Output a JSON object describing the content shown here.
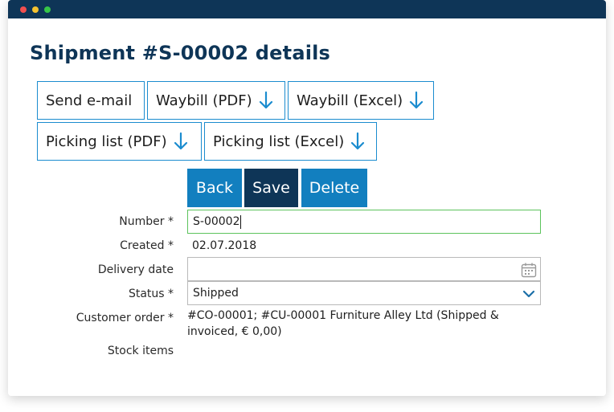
{
  "page_title": "Shipment #S-00002 details",
  "actions_row1": [
    {
      "label": "Send e-mail",
      "icon": null
    },
    {
      "label": "Waybill (PDF)",
      "icon": "download-arrow-icon"
    },
    {
      "label": "Waybill (Excel)",
      "icon": "download-arrow-icon"
    }
  ],
  "actions_row2": [
    {
      "label": "Picking list (PDF)",
      "icon": "download-arrow-icon"
    },
    {
      "label": "Picking list (Excel)",
      "icon": "download-arrow-icon"
    }
  ],
  "form_buttons": {
    "back": "Back",
    "save": "Save",
    "delete": "Delete"
  },
  "fields": {
    "number": {
      "label": "Number *",
      "value": "S-00002"
    },
    "created": {
      "label": "Created *",
      "value": "02.07.2018"
    },
    "delivery_date": {
      "label": "Delivery date",
      "value": ""
    },
    "status": {
      "label": "Status *",
      "value": "Shipped"
    },
    "customer_order": {
      "label": "Customer order *",
      "value": "#CO-00001; #CU-00001 Furniture Alley Ltd (Shipped & invoiced, € 0,00)"
    },
    "stock_items": {
      "label": "Stock items"
    }
  },
  "colors": {
    "titlebar": "#0e3557",
    "title_text": "#0e3557",
    "outline_border": "#1b8ccf",
    "arrow": "#1b8ccf",
    "back_bg": "#127fbf",
    "save_bg": "#0e3557",
    "delete_bg": "#127fbf",
    "focus_border": "#5cc35c"
  }
}
